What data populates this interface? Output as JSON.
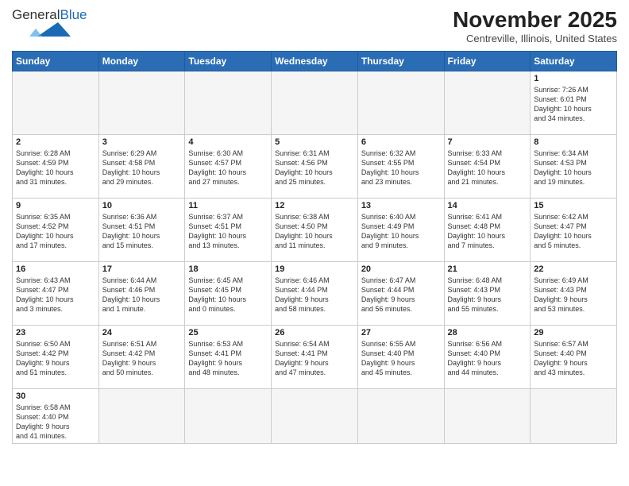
{
  "header": {
    "logo_general": "General",
    "logo_blue": "Blue",
    "month_title": "November 2025",
    "location": "Centreville, Illinois, United States"
  },
  "weekdays": [
    "Sunday",
    "Monday",
    "Tuesday",
    "Wednesday",
    "Thursday",
    "Friday",
    "Saturday"
  ],
  "weeks": [
    [
      {
        "day": "",
        "info": ""
      },
      {
        "day": "",
        "info": ""
      },
      {
        "day": "",
        "info": ""
      },
      {
        "day": "",
        "info": ""
      },
      {
        "day": "",
        "info": ""
      },
      {
        "day": "",
        "info": ""
      },
      {
        "day": "1",
        "info": "Sunrise: 7:26 AM\nSunset: 6:01 PM\nDaylight: 10 hours\nand 34 minutes."
      }
    ],
    [
      {
        "day": "2",
        "info": "Sunrise: 6:28 AM\nSunset: 4:59 PM\nDaylight: 10 hours\nand 31 minutes."
      },
      {
        "day": "3",
        "info": "Sunrise: 6:29 AM\nSunset: 4:58 PM\nDaylight: 10 hours\nand 29 minutes."
      },
      {
        "day": "4",
        "info": "Sunrise: 6:30 AM\nSunset: 4:57 PM\nDaylight: 10 hours\nand 27 minutes."
      },
      {
        "day": "5",
        "info": "Sunrise: 6:31 AM\nSunset: 4:56 PM\nDaylight: 10 hours\nand 25 minutes."
      },
      {
        "day": "6",
        "info": "Sunrise: 6:32 AM\nSunset: 4:55 PM\nDaylight: 10 hours\nand 23 minutes."
      },
      {
        "day": "7",
        "info": "Sunrise: 6:33 AM\nSunset: 4:54 PM\nDaylight: 10 hours\nand 21 minutes."
      },
      {
        "day": "8",
        "info": "Sunrise: 6:34 AM\nSunset: 4:53 PM\nDaylight: 10 hours\nand 19 minutes."
      }
    ],
    [
      {
        "day": "9",
        "info": "Sunrise: 6:35 AM\nSunset: 4:52 PM\nDaylight: 10 hours\nand 17 minutes."
      },
      {
        "day": "10",
        "info": "Sunrise: 6:36 AM\nSunset: 4:51 PM\nDaylight: 10 hours\nand 15 minutes."
      },
      {
        "day": "11",
        "info": "Sunrise: 6:37 AM\nSunset: 4:51 PM\nDaylight: 10 hours\nand 13 minutes."
      },
      {
        "day": "12",
        "info": "Sunrise: 6:38 AM\nSunset: 4:50 PM\nDaylight: 10 hours\nand 11 minutes."
      },
      {
        "day": "13",
        "info": "Sunrise: 6:40 AM\nSunset: 4:49 PM\nDaylight: 10 hours\nand 9 minutes."
      },
      {
        "day": "14",
        "info": "Sunrise: 6:41 AM\nSunset: 4:48 PM\nDaylight: 10 hours\nand 7 minutes."
      },
      {
        "day": "15",
        "info": "Sunrise: 6:42 AM\nSunset: 4:47 PM\nDaylight: 10 hours\nand 5 minutes."
      }
    ],
    [
      {
        "day": "16",
        "info": "Sunrise: 6:43 AM\nSunset: 4:47 PM\nDaylight: 10 hours\nand 3 minutes."
      },
      {
        "day": "17",
        "info": "Sunrise: 6:44 AM\nSunset: 4:46 PM\nDaylight: 10 hours\nand 1 minute."
      },
      {
        "day": "18",
        "info": "Sunrise: 6:45 AM\nSunset: 4:45 PM\nDaylight: 10 hours\nand 0 minutes."
      },
      {
        "day": "19",
        "info": "Sunrise: 6:46 AM\nSunset: 4:44 PM\nDaylight: 9 hours\nand 58 minutes."
      },
      {
        "day": "20",
        "info": "Sunrise: 6:47 AM\nSunset: 4:44 PM\nDaylight: 9 hours\nand 56 minutes."
      },
      {
        "day": "21",
        "info": "Sunrise: 6:48 AM\nSunset: 4:43 PM\nDaylight: 9 hours\nand 55 minutes."
      },
      {
        "day": "22",
        "info": "Sunrise: 6:49 AM\nSunset: 4:43 PM\nDaylight: 9 hours\nand 53 minutes."
      }
    ],
    [
      {
        "day": "23",
        "info": "Sunrise: 6:50 AM\nSunset: 4:42 PM\nDaylight: 9 hours\nand 51 minutes."
      },
      {
        "day": "24",
        "info": "Sunrise: 6:51 AM\nSunset: 4:42 PM\nDaylight: 9 hours\nand 50 minutes."
      },
      {
        "day": "25",
        "info": "Sunrise: 6:53 AM\nSunset: 4:41 PM\nDaylight: 9 hours\nand 48 minutes."
      },
      {
        "day": "26",
        "info": "Sunrise: 6:54 AM\nSunset: 4:41 PM\nDaylight: 9 hours\nand 47 minutes."
      },
      {
        "day": "27",
        "info": "Sunrise: 6:55 AM\nSunset: 4:40 PM\nDaylight: 9 hours\nand 45 minutes."
      },
      {
        "day": "28",
        "info": "Sunrise: 6:56 AM\nSunset: 4:40 PM\nDaylight: 9 hours\nand 44 minutes."
      },
      {
        "day": "29",
        "info": "Sunrise: 6:57 AM\nSunset: 4:40 PM\nDaylight: 9 hours\nand 43 minutes."
      }
    ],
    [
      {
        "day": "30",
        "info": "Sunrise: 6:58 AM\nSunset: 4:40 PM\nDaylight: 9 hours\nand 41 minutes."
      },
      {
        "day": "",
        "info": ""
      },
      {
        "day": "",
        "info": ""
      },
      {
        "day": "",
        "info": ""
      },
      {
        "day": "",
        "info": ""
      },
      {
        "day": "",
        "info": ""
      },
      {
        "day": "",
        "info": ""
      }
    ]
  ]
}
